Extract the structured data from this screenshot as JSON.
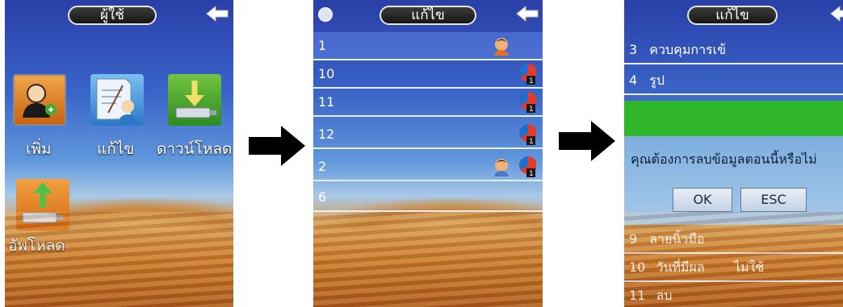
{
  "screen1": {
    "title": "ผู้ใช้",
    "items": [
      {
        "label": "เพิ่ม"
      },
      {
        "label": "แก้ไข"
      },
      {
        "label": "ดาวน์โหลด"
      },
      {
        "label": "อัพโหลด"
      }
    ]
  },
  "screen2": {
    "title": "แก้ไข",
    "rows": [
      {
        "id": "1"
      },
      {
        "id": "10"
      },
      {
        "id": "11"
      },
      {
        "id": "12"
      },
      {
        "id": "2"
      },
      {
        "id": "6"
      }
    ]
  },
  "screen3": {
    "title": "แก้ไข",
    "rows_top": [
      {
        "num": "3",
        "label": "ควบคุมการเข้"
      },
      {
        "num": "4",
        "label": "รูป"
      }
    ],
    "rows_bottom": [
      {
        "num": "9",
        "label": "ลายนิ้วมือ",
        "value": ""
      },
      {
        "num": "10",
        "label": "วันที่มีผล",
        "value": "ไม่ใช้"
      },
      {
        "num": "11",
        "label": "ลบ",
        "value": ""
      }
    ],
    "dialog": {
      "message": "คุณต้องการลบข้อมูลตอนนี้หรือไม่",
      "ok_label": "OK",
      "esc_label": "ESC"
    }
  },
  "icons": [
    "back-arrow-icon",
    "add-user-icon",
    "edit-user-icon",
    "download-icon",
    "upload-icon",
    "face-icon",
    "card-icon",
    "arrow-right-icon"
  ],
  "colors": {
    "accent_green": "#2fb52a",
    "pill": "#1f1f1f",
    "arrow": "#000000"
  }
}
